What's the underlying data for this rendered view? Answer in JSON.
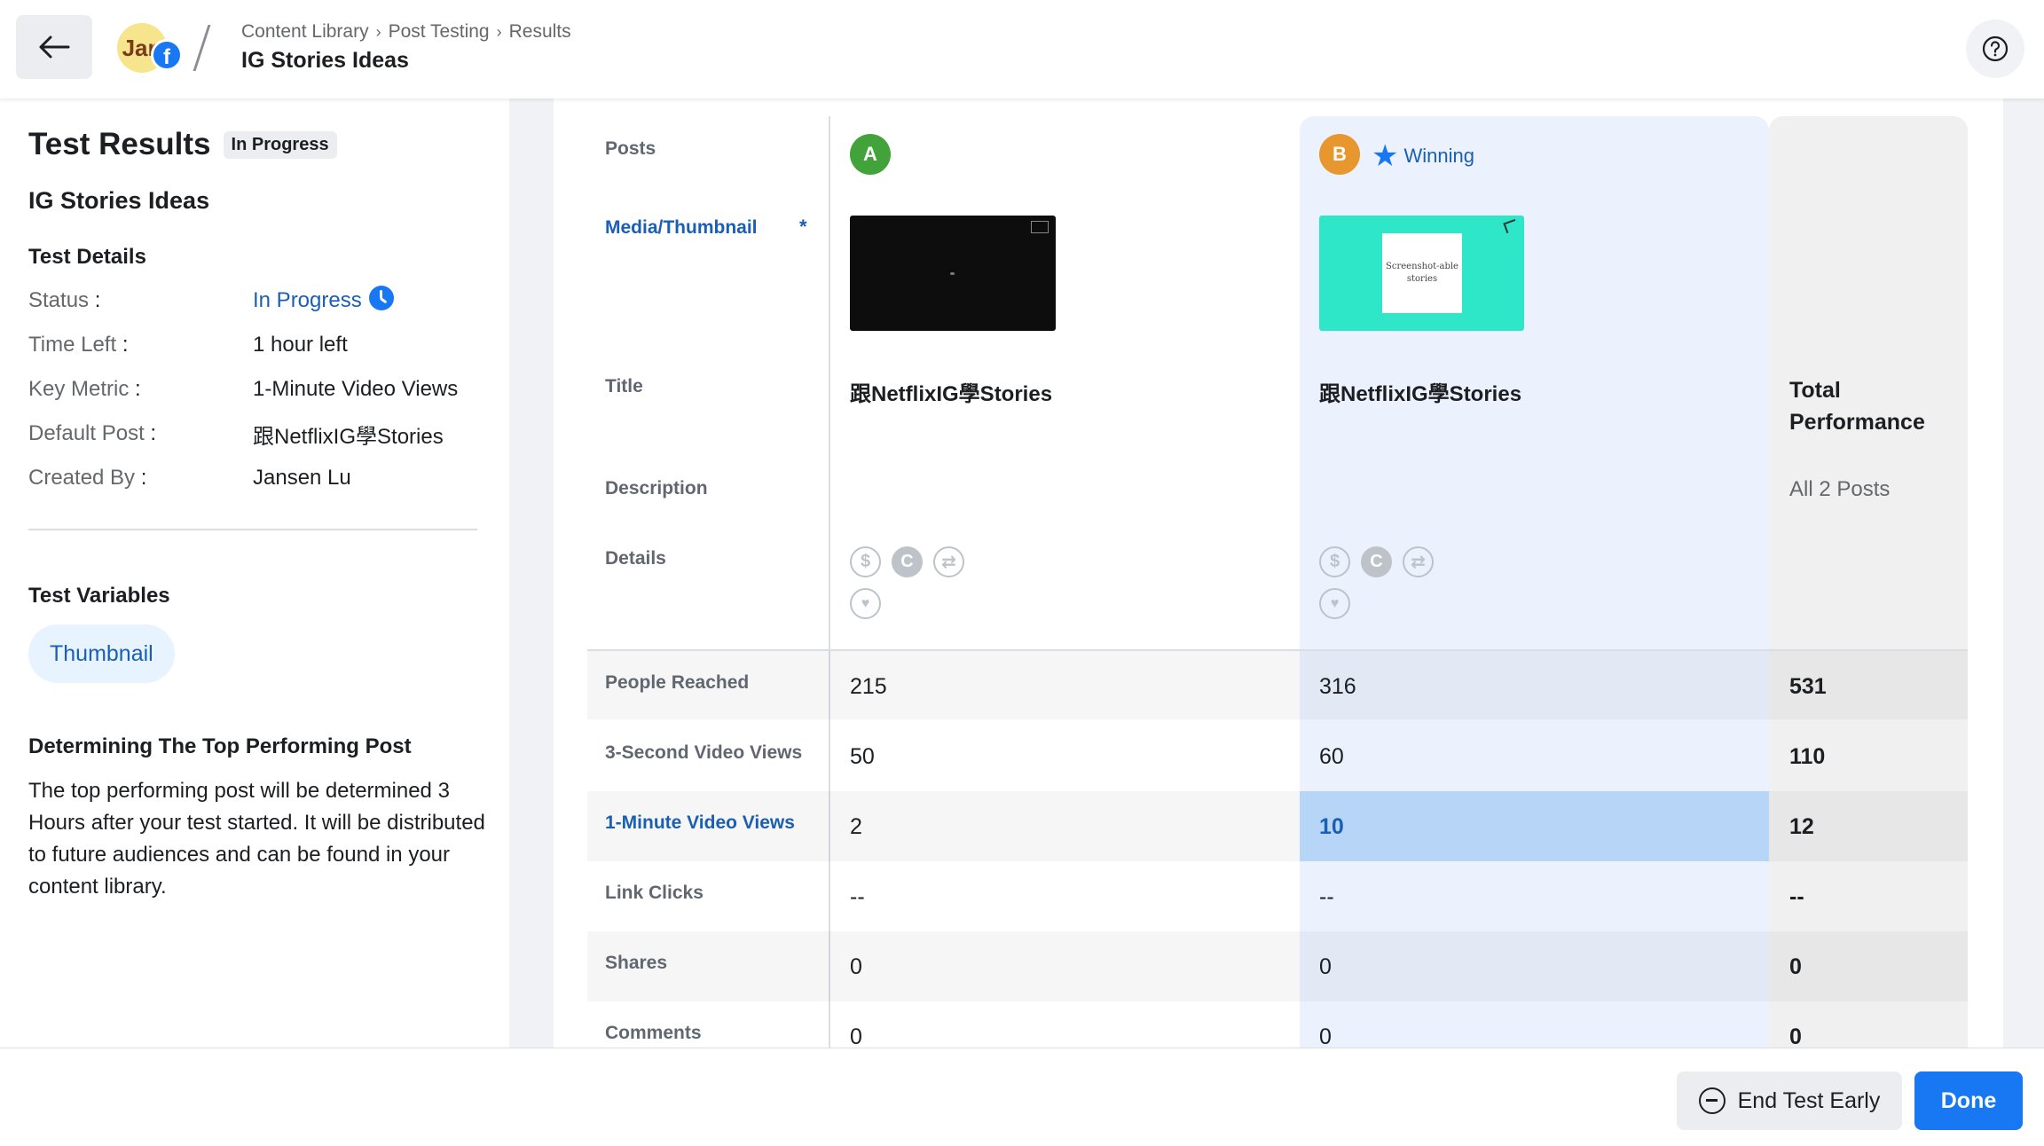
{
  "header": {
    "avatar_text": "Jan",
    "breadcrumb": [
      "Content Library",
      "Post Testing",
      "Results"
    ],
    "title": "IG Stories Ideas"
  },
  "left_panel": {
    "title": "Test Results",
    "status_badge": "In Progress",
    "subtitle": "IG Stories Ideas",
    "details_heading": "Test Details",
    "details": [
      {
        "label": "Status",
        "value": "In Progress"
      },
      {
        "label": "Time Left",
        "value": "1 hour left"
      },
      {
        "label": "Key Metric",
        "value": "1-Minute Video Views"
      },
      {
        "label": "Default Post",
        "value": "跟NetflixIG學Stories"
      },
      {
        "label": "Created By",
        "value": "Jansen Lu"
      }
    ],
    "variables_heading": "Test Variables",
    "variable_pill": "Thumbnail",
    "determine_heading": "Determining The Top Performing Post",
    "determine_text": "The top performing post will be determined 3 Hours after your test started. It will be distributed to future audiences and can be found in your content library."
  },
  "table": {
    "row_labels": {
      "posts": "Posts",
      "media": "Media/Thumbnail",
      "required_mark": "*",
      "title": "Title",
      "description": "Description",
      "details": "Details"
    },
    "post_a": {
      "badge": "A",
      "badge_color": "#42a33a",
      "title": "跟NetflixIG學Stories"
    },
    "post_b": {
      "badge": "B",
      "badge_color": "#e8962e",
      "title": "跟NetflixIG學Stories",
      "winning_label": "Winning",
      "thumb_text": "Screenshot-able stories"
    },
    "total": {
      "title": "Total Performance",
      "subtitle": "All 2 Posts"
    },
    "metrics": [
      {
        "label": "People Reached",
        "a": "215",
        "b": "316",
        "total": "531"
      },
      {
        "label": "3-Second Video Views",
        "a": "50",
        "b": "60",
        "total": "110"
      },
      {
        "label": "1-Minute Video Views",
        "a": "2",
        "b": "10",
        "total": "12"
      },
      {
        "label": "Link Clicks",
        "a": "--",
        "b": "--",
        "total": "--"
      },
      {
        "label": "Shares",
        "a": "0",
        "b": "0",
        "total": "0"
      },
      {
        "label": "Comments",
        "a": "0",
        "b": "0",
        "total": "0"
      }
    ]
  },
  "footer": {
    "end_label": "End Test Early",
    "done_label": "Done"
  },
  "colors": {
    "accent": "#1877f2",
    "link": "#1a5fb4",
    "winning_column": "#ebf2fd",
    "winning_highlight": "#b7d6f7"
  }
}
